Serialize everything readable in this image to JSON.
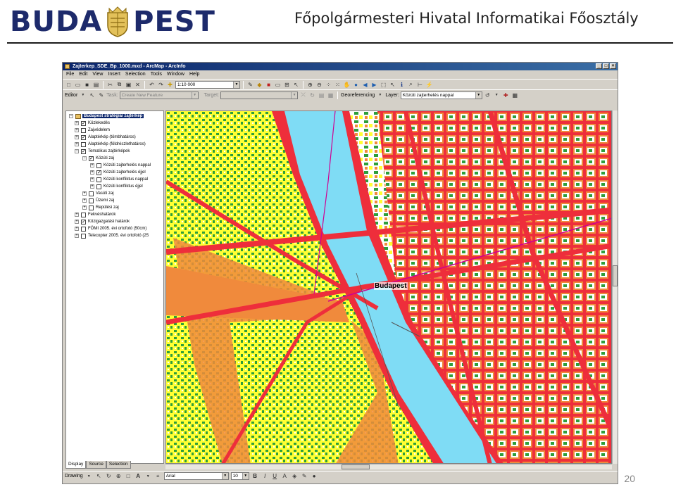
{
  "slide": {
    "logo_left": "BUDA",
    "logo_right": "PEST",
    "title": "Főpolgármesteri Hivatal Informatikai Főosztály",
    "page_number": "20"
  },
  "colors": {
    "logo": "#1d2a6b",
    "title_bar": "#0a246a",
    "river": "#7fdcf5",
    "noise_high": "#ee2e3b",
    "noise_mid": "#f08a3c",
    "noise_low": "#ffff33",
    "green": "#2e9e3a",
    "buildings": "#ffffff"
  },
  "app": {
    "title": "Zajterkep_SDE_Bp_1000.mxd - ArcMap - ArcInfo",
    "menu": [
      "File",
      "Edit",
      "View",
      "Insert",
      "Selection",
      "Tools",
      "Window",
      "Help"
    ],
    "scale": "1:10 000",
    "editor_label": "Editor",
    "task_label": "Task:",
    "task_value": "Create New Feature",
    "target_label": "Target:",
    "georef_label": "Georeferencing",
    "layer_label": "Layer:",
    "layer_value": "Közúti zajterhelés nappal",
    "drawing_label": "Drawing",
    "font_value": "Arial",
    "font_size": "10"
  },
  "toc": {
    "root": "Budapest stratégiai zajtérkép",
    "items": [
      {
        "label": "Közlekedés",
        "checked": true
      },
      {
        "label": "Zajvédelem",
        "checked": false
      },
      {
        "label": "Alaptérkép (tömbhatáros)",
        "checked": true
      },
      {
        "label": "Alaptérkép (földrészlethatáros)",
        "checked": false
      },
      {
        "label": "Tematikus zajtérképek",
        "checked": true
      },
      {
        "label": "Közúti zaj",
        "checked": true
      },
      {
        "label": "Közúti zajterhelés nappal",
        "checked": false
      },
      {
        "label": "Közúti zajterhelés éjjel",
        "checked": true
      },
      {
        "label": "Közúti konfliktus nappal",
        "checked": false
      },
      {
        "label": "Közúti konfliktus éjjel",
        "checked": false
      },
      {
        "label": "Vasúti zaj",
        "checked": false
      },
      {
        "label": "Üzemi zaj",
        "checked": false
      },
      {
        "label": "Repülési zaj",
        "checked": false
      },
      {
        "label": "Fekvéshatárok",
        "checked": false
      },
      {
        "label": "Közigazgatási határok",
        "checked": true
      },
      {
        "label": "FÖMI 2005. évi ortofotó (50cm)",
        "checked": false
      },
      {
        "label": "Telecopter 2005. évi ortofotó (25",
        "checked": false
      }
    ],
    "tabs": [
      "Display",
      "Source",
      "Selection"
    ]
  },
  "map": {
    "city_label": "Budapest"
  }
}
